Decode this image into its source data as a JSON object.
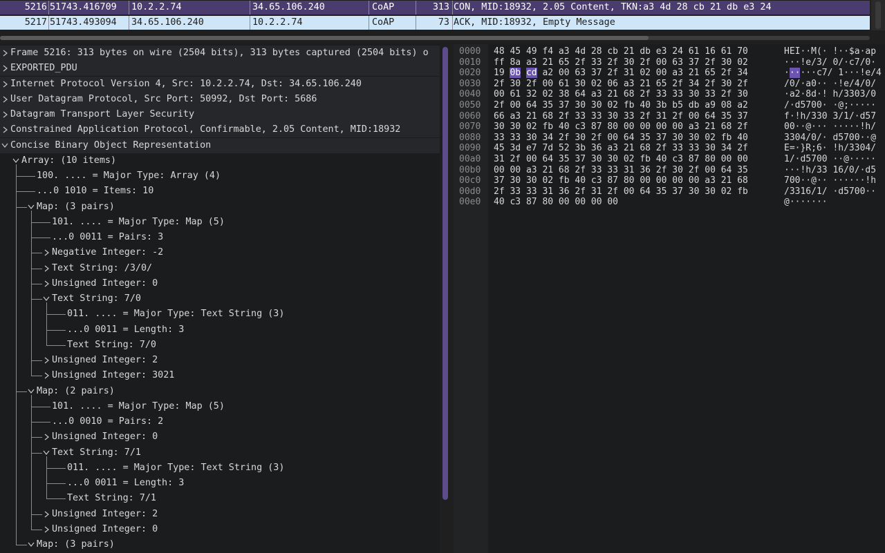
{
  "packets": [
    {
      "no": "5216",
      "time": "51743.416709",
      "src": "10.2.2.74",
      "dst": "34.65.106.240",
      "proto": "CoAP",
      "len": "313",
      "info": "CON, MID:18932, 2.05 Content, TKN:a3 4d 28 cb 21 db e3 24"
    },
    {
      "no": "5217",
      "time": "51743.493094",
      "src": "34.65.106.240",
      "dst": "10.2.2.74",
      "proto": "CoAP",
      "len": "73",
      "info": "ACK, MID:18932, Empty Message"
    }
  ],
  "tree": [
    {
      "text": "Frame 5216: 313 bytes on wire (2504 bits), 313 bytes captured (2504 bits) o",
      "d": 0,
      "chev": "right",
      "shade": true
    },
    {
      "text": "EXPORTED_PDU",
      "d": 0,
      "chev": "right",
      "shade": true
    },
    {
      "text": "Internet Protocol Version 4, Src: 10.2.2.74, Dst: 34.65.106.240",
      "d": 0,
      "chev": "right",
      "shade": true
    },
    {
      "text": "User Datagram Protocol, Src Port: 50992, Dst Port: 5686",
      "d": 0,
      "chev": "right",
      "shade": true
    },
    {
      "text": "Datagram Transport Layer Security",
      "d": 0,
      "chev": "right",
      "shade": true
    },
    {
      "text": "Constrained Application Protocol, Confirmable, 2.05 Content, MID:18932",
      "d": 0,
      "chev": "right",
      "shade": true
    },
    {
      "text": "Concise Binary Object Representation",
      "d": 0,
      "chev": "down",
      "shade": true
    },
    {
      "text": "Array: (10 items)",
      "d": 1,
      "chev": "down"
    },
    {
      "text": "100. .... = Major Type: Array (4)",
      "d": 2,
      "chev": "none"
    },
    {
      "text": "...0 1010 = Items: 10",
      "d": 2,
      "chev": "none"
    },
    {
      "text": "Map: (3 pairs)",
      "d": 2,
      "chev": "down"
    },
    {
      "text": "101. .... = Major Type: Map (5)",
      "d": 3,
      "chev": "none"
    },
    {
      "text": "...0 0011 = Pairs: 3",
      "d": 3,
      "chev": "none"
    },
    {
      "text": "Negative Integer: -2",
      "d": 3,
      "chev": "right"
    },
    {
      "text": "Text String: /3/0/",
      "d": 3,
      "chev": "right"
    },
    {
      "text": "Unsigned Integer: 0",
      "d": 3,
      "chev": "right"
    },
    {
      "text": "Text String: 7/0",
      "d": 3,
      "chev": "down"
    },
    {
      "text": "011. .... = Major Type: Text String (3)",
      "d": 4,
      "chev": "none"
    },
    {
      "text": "...0 0011 = Length: 3",
      "d": 4,
      "chev": "none"
    },
    {
      "text": "Text String: 7/0",
      "d": 4,
      "chev": "none"
    },
    {
      "text": "Unsigned Integer: 2",
      "d": 3,
      "chev": "right"
    },
    {
      "text": "Unsigned Integer: 3021",
      "d": 3,
      "chev": "right"
    },
    {
      "text": "Map: (2 pairs)",
      "d": 2,
      "chev": "down"
    },
    {
      "text": "101. .... = Major Type: Map (5)",
      "d": 3,
      "chev": "none"
    },
    {
      "text": "...0 0010 = Pairs: 2",
      "d": 3,
      "chev": "none"
    },
    {
      "text": "Unsigned Integer: 0",
      "d": 3,
      "chev": "right"
    },
    {
      "text": "Text String: 7/1",
      "d": 3,
      "chev": "down"
    },
    {
      "text": "011. .... = Major Type: Text String (3)",
      "d": 4,
      "chev": "none"
    },
    {
      "text": "...0 0011 = Length: 3",
      "d": 4,
      "chev": "none"
    },
    {
      "text": "Text String: 7/1",
      "d": 4,
      "chev": "none"
    },
    {
      "text": "Unsigned Integer: 2",
      "d": 3,
      "chev": "right"
    },
    {
      "text": "Unsigned Integer: 0",
      "d": 3,
      "chev": "right"
    },
    {
      "text": "Map: (3 pairs)",
      "d": 2,
      "chev": "down"
    }
  ],
  "bytes": [
    {
      "off": "0000",
      "hex": "48 45 49 f4 a3 4d 28 cb  21 db e3 24 61 16 61 70",
      "asc": "HEI··M(· !··$a·ap"
    },
    {
      "off": "0010",
      "hex": "ff 8a a3 21 65 2f 33 2f  30 2f 00 63 37 2f 30 02",
      "asc": "···!e/3/ 0/·c7/0·"
    },
    {
      "off": "0020",
      "hex": "19 0b cd a2 00 63 37 2f  31 02 00 a3 21 65 2f 34",
      "asc": "······c7/ 1···!e/4",
      "hlhex": [
        1,
        2
      ],
      "hlasc": [
        1,
        2
      ]
    },
    {
      "off": "0030",
      "hex": "2f 30 2f 00 61 30 02 06  a3 21 65 2f 34 2f 30 2f",
      "asc": "/0/·a0·· ·!e/4/0/"
    },
    {
      "off": "0040",
      "hex": "00 61 32 02 38 64 a3 21  68 2f 33 33 30 33 2f 30",
      "asc": "·a2·8d·! h/3303/0"
    },
    {
      "off": "0050",
      "hex": "2f 00 64 35 37 30 30 02  fb 40 3b b5 db a9 08 a2",
      "asc": "/·d5700· ·@;·····"
    },
    {
      "off": "0060",
      "hex": "66 a3 21 68 2f 33 33 30  33 2f 31 2f 00 64 35 37",
      "asc": "f·!h/330 3/1/·d57"
    },
    {
      "off": "0070",
      "hex": "30 30 02 fb 40 c3 87 80  00 00 00 00 a3 21 68 2f",
      "asc": "00··@··· ·····!h/"
    },
    {
      "off": "0080",
      "hex": "33 33 30 34 2f 30 2f 00  64 35 37 30 30 02 fb 40",
      "asc": "3304/0/· d5700··@"
    },
    {
      "off": "0090",
      "hex": "45 3d e7 7d 52 3b 36 a3  21 68 2f 33 33 30 34 2f",
      "asc": "E=·}R;6· !h/3304/"
    },
    {
      "off": "00a0",
      "hex": "31 2f 00 64 35 37 30 30  02 fb 40 c3 87 80 00 00",
      "asc": "1/·d5700 ··@·····"
    },
    {
      "off": "00b0",
      "hex": "00 00 a3 21 68 2f 33 33  31 36 2f 30 2f 00 64 35",
      "asc": "···!h/33 16/0/·d5"
    },
    {
      "off": "00c0",
      "hex": "37 30 30 02 fb 40 c3 87  80 00 00 00 00 a3 21 68",
      "asc": "700··@·· ······!h"
    },
    {
      "off": "00d0",
      "hex": "2f 33 33 31 36 2f 31 2f  00 64 35 37 30 30 02 fb",
      "asc": "/3316/1/ ·d5700··"
    },
    {
      "off": "00e0",
      "hex": "40 c3 87 80 00 00 00 00",
      "asc": "@·······"
    }
  ],
  "colors": {
    "selected_row": "#4a3c6e",
    "ack_row": "#cfe6f8",
    "byte_highlight": "#6b55b0",
    "scroll_accent": "#5c4c8a"
  },
  "icons": {
    "expanded": "chevron-down-icon",
    "collapsed": "chevron-right-icon"
  }
}
